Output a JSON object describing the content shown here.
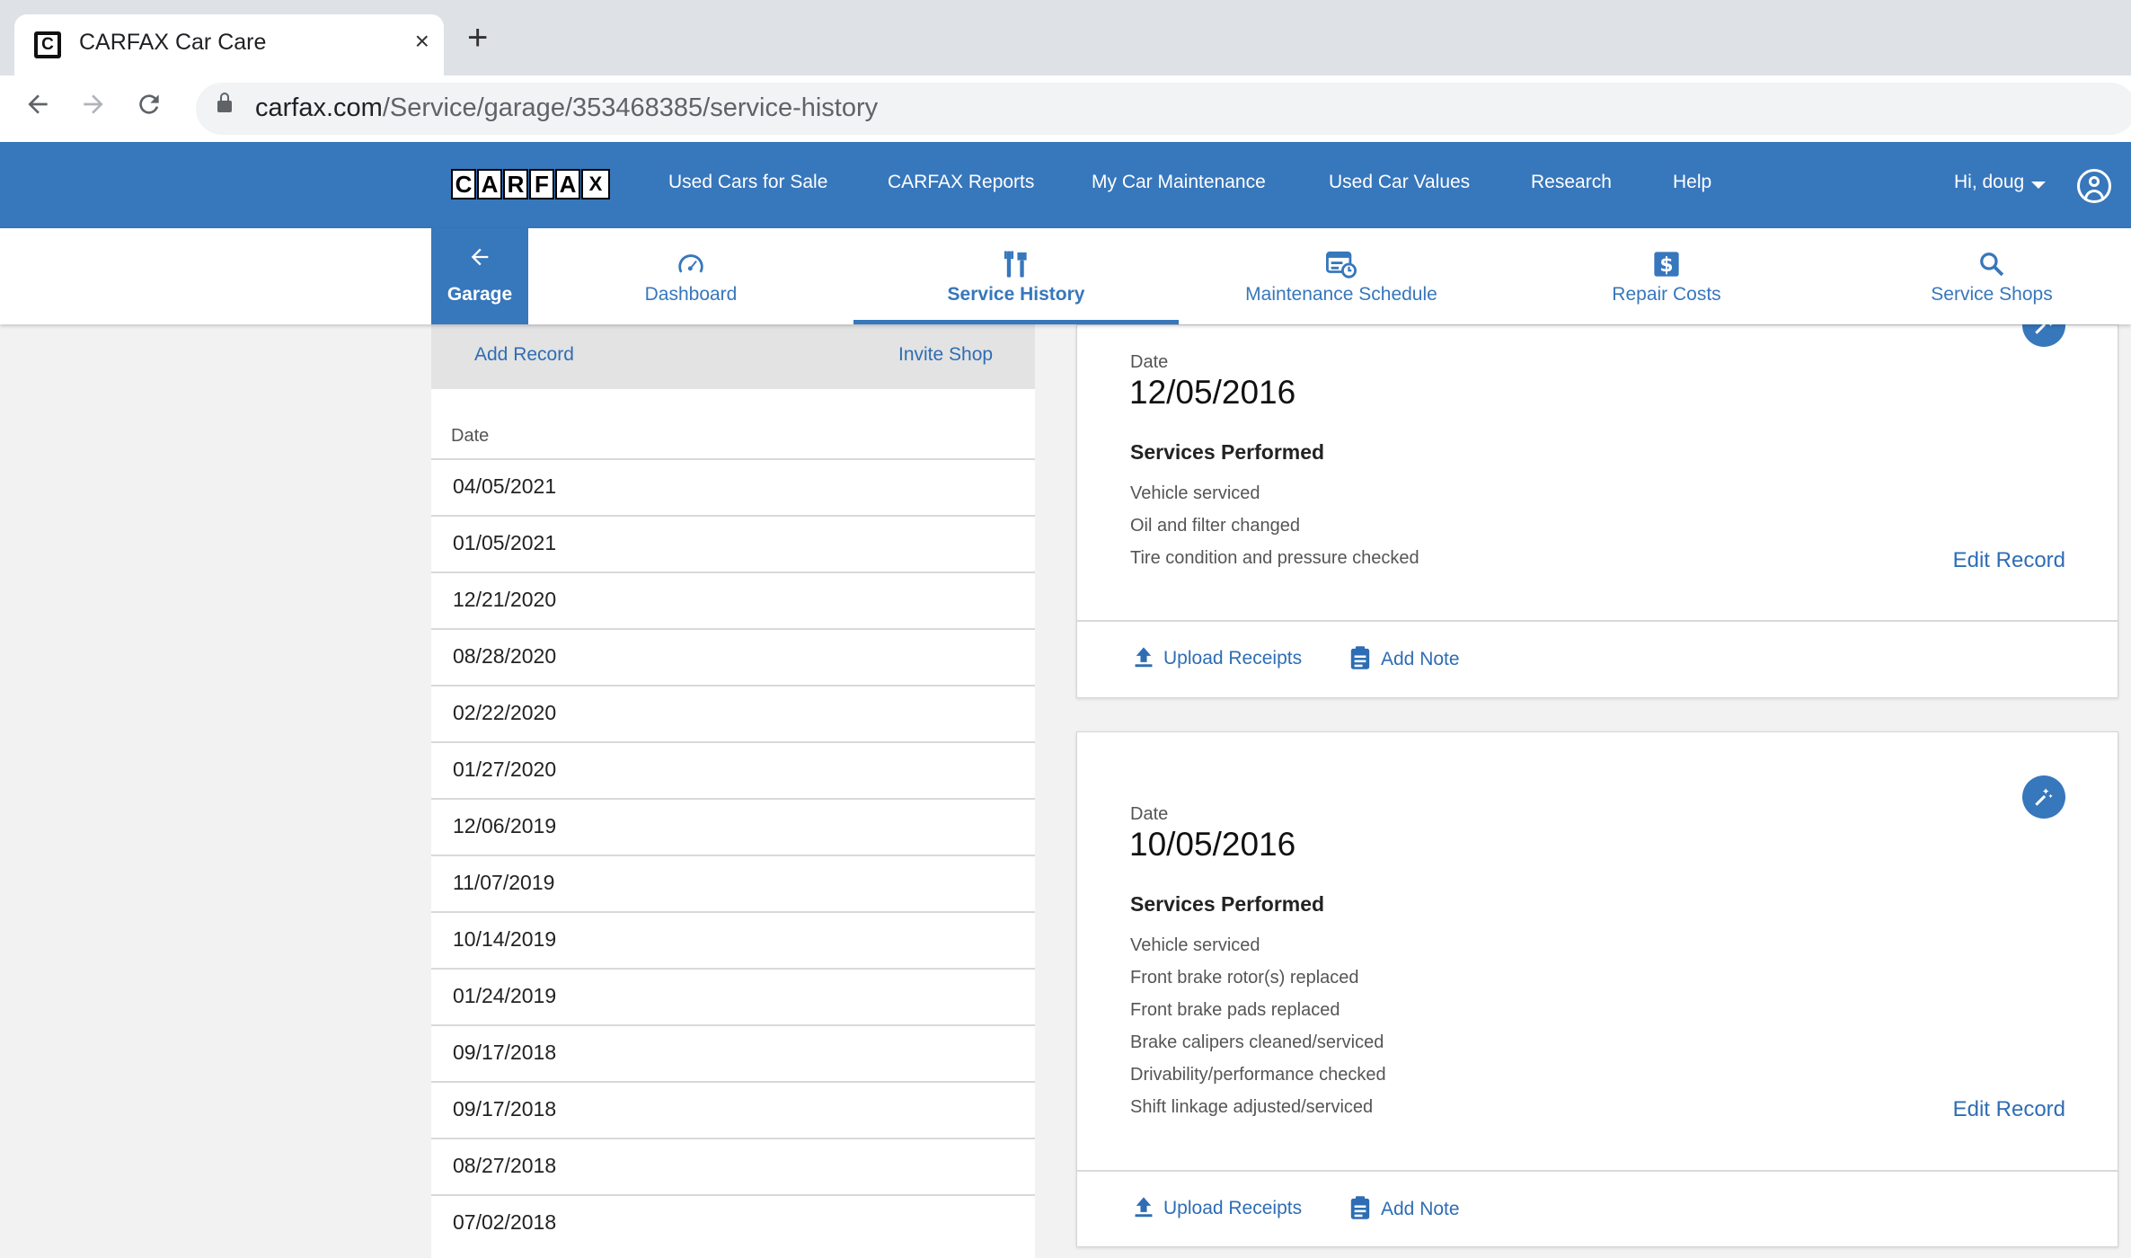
{
  "browser": {
    "tab_title": "CARFAX Car Care",
    "tab_close": "×",
    "new_tab": "+",
    "url_domain": "carfax.com",
    "url_path": "/Service/garage/353468385/service-history"
  },
  "header": {
    "logo_letters": [
      "C",
      "A",
      "R",
      "F",
      "A",
      "X"
    ],
    "nav": [
      "Used Cars for Sale",
      "CARFAX Reports",
      "My Car Maintenance",
      "Used Car Values",
      "Research",
      "Help"
    ],
    "user_greeting": "Hi, doug"
  },
  "subnav": {
    "garage": "Garage",
    "tabs": [
      {
        "label": "Dashboard",
        "icon": "speedometer-icon"
      },
      {
        "label": "Service History",
        "icon": "tools-icon",
        "active": true
      },
      {
        "label": "Maintenance Schedule",
        "icon": "calendar-clock-icon"
      },
      {
        "label": "Repair Costs",
        "icon": "dollar-icon"
      },
      {
        "label": "Service Shops",
        "icon": "search-icon"
      }
    ]
  },
  "left_panel": {
    "add_record": "Add Record",
    "invite_shop": "Invite Shop",
    "column_header": "Date",
    "dates": [
      "04/05/2021",
      "01/05/2021",
      "12/21/2020",
      "08/28/2020",
      "02/22/2020",
      "01/27/2020",
      "12/06/2019",
      "11/07/2019",
      "10/14/2019",
      "01/24/2019",
      "09/17/2018",
      "09/17/2018",
      "08/27/2018",
      "07/02/2018"
    ]
  },
  "records": [
    {
      "date_label": "Date",
      "date": "12/05/2016",
      "services_title": "Services Performed",
      "services": [
        "Vehicle serviced",
        "Oil and filter changed",
        "Tire condition and pressure checked"
      ],
      "edit": "Edit Record",
      "upload": "Upload Receipts",
      "note": "Add Note"
    },
    {
      "date_label": "Date",
      "date": "10/05/2016",
      "services_title": "Services Performed",
      "services": [
        "Vehicle serviced",
        "Front brake rotor(s) replaced",
        "Front brake pads replaced",
        "Brake calipers cleaned/serviced",
        "Drivability/performance checked",
        "Shift linkage adjusted/serviced"
      ],
      "edit": "Edit Record",
      "upload": "Upload Receipts",
      "note": "Add Note"
    }
  ],
  "colors": {
    "brand_blue": "#3777bc",
    "link_blue": "#2e6db4"
  }
}
